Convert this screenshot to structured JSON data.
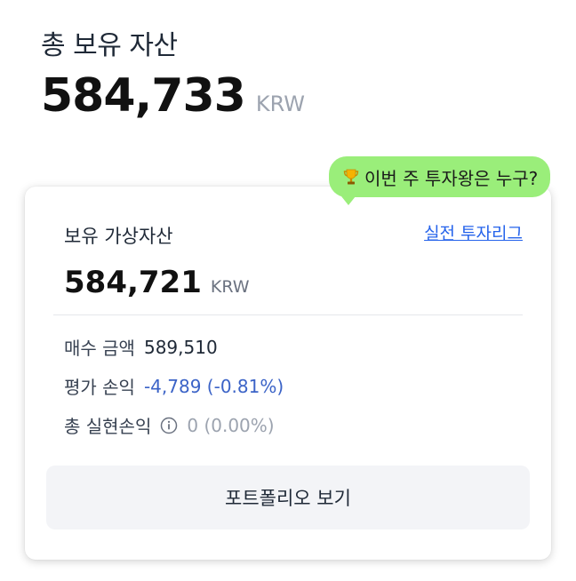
{
  "summary": {
    "total_label": "총 보유 자산",
    "total_amount": "584,733",
    "total_currency": "KRW"
  },
  "tooltip": {
    "icon": "trophy-icon",
    "text": "이번 주 투자왕은 누구?",
    "background": "#9aee7a"
  },
  "card": {
    "virtual_label": "보유 가상자산",
    "league_link": "실전 투자리그",
    "virtual_amount": "584,721",
    "virtual_currency": "KRW",
    "stats": [
      {
        "label": "매수 금액",
        "value": "589,510"
      },
      {
        "label": "평가 손익",
        "value": "-4,789 (-0.81%)",
        "color": "#3b63c7"
      },
      {
        "label": "총 실현손익",
        "value": "0 (0.00%)",
        "icon": "info-icon"
      }
    ],
    "portfolio_button": "포트폴리오 보기"
  }
}
